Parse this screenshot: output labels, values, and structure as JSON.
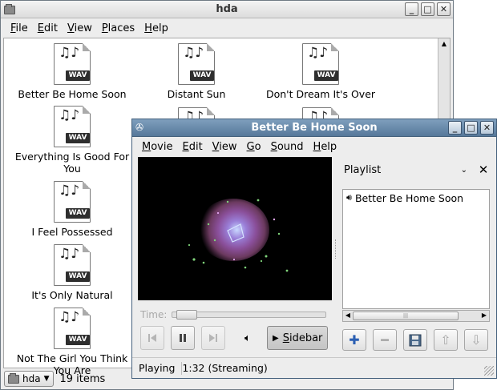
{
  "fm": {
    "title": "hda",
    "menu": [
      "File",
      "Edit",
      "View",
      "Places",
      "Help"
    ],
    "items": [
      {
        "name": "Better Be Home Soon"
      },
      {
        "name": "Distant Sun"
      },
      {
        "name": "Don't Dream It's Over"
      },
      {
        "name": "Everything Is Good For You"
      },
      {
        "name": "I Feel Possessed"
      },
      {
        "name": "It's Only Natural"
      },
      {
        "name": "Not The Girl You Think You Are"
      }
    ],
    "file_label": "WAV",
    "location": "hda",
    "item_count": "19 items"
  },
  "player": {
    "title": "Better Be Home Soon",
    "menu": [
      "Movie",
      "Edit",
      "View",
      "Go",
      "Sound",
      "Help"
    ],
    "time_label": "Time:",
    "progress": 0.03,
    "sidebar_button": "Sidebar",
    "sidebar_title": "Playlist",
    "playlist": [
      {
        "title": "Better Be Home Soon",
        "playing": true
      }
    ],
    "status": {
      "state": "Playing",
      "time": "1:32 (Streaming)"
    }
  }
}
